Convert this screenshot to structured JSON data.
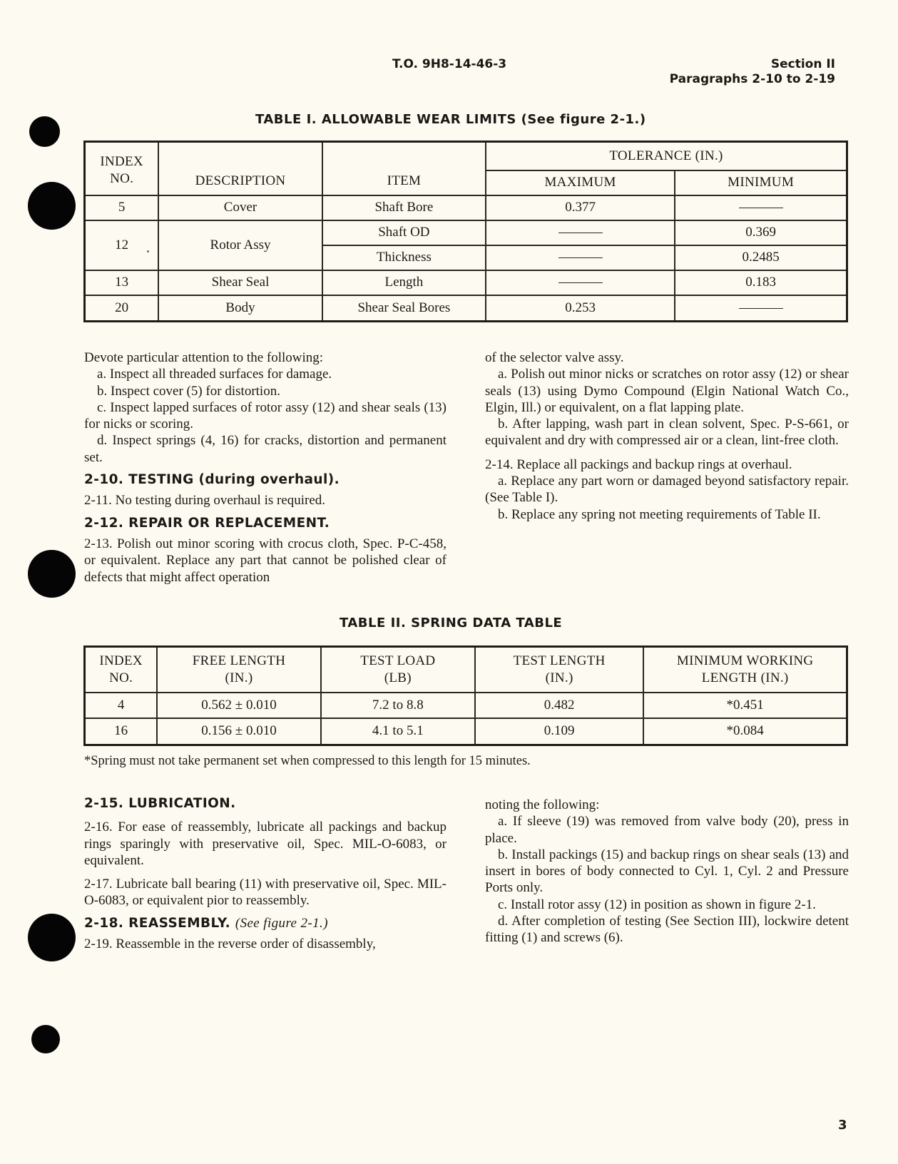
{
  "header": {
    "doc_number": "T.O. 9H8-14-46-3",
    "section": "Section II",
    "paragraphs": "Paragraphs 2-10 to 2-19"
  },
  "table1": {
    "caption": "TABLE I.  ALLOWABLE WEAR LIMITS (See figure 2-1.)",
    "headers": {
      "index_line1": "INDEX",
      "index_line2": "NO.",
      "description": "DESCRIPTION",
      "item": "ITEM",
      "tolerance": "TOLERANCE (IN.)",
      "maximum": "MAXIMUM",
      "minimum": "MINIMUM"
    },
    "rows": [
      {
        "index": "5",
        "description": "Cover",
        "item": "Shaft Bore",
        "maximum": "0.377",
        "minimum": "—"
      },
      {
        "index": "12",
        "description": "Rotor Assy",
        "item": "Shaft OD",
        "maximum": "—",
        "minimum": "0.369"
      },
      {
        "index": "",
        "description": "",
        "item": "Thickness",
        "maximum": "—",
        "minimum": "0.2485"
      },
      {
        "index": "13",
        "description": "Shear Seal",
        "item": "Length",
        "maximum": "—",
        "minimum": "0.183"
      },
      {
        "index": "20",
        "description": "Body",
        "item": "Shear Seal Bores",
        "maximum": "0.253",
        "minimum": "—"
      }
    ]
  },
  "left_col_top": {
    "intro": "Devote particular attention to the following:",
    "a": "a. Inspect all threaded surfaces for damage.",
    "b": "b. Inspect cover (5) for distortion.",
    "c": "c. Inspect lapped surfaces of rotor assy (12) and shear seals (13) for nicks or scoring.",
    "d": "d. Inspect springs (4, 16) for cracks, distortion and permanent set.",
    "h_2_10": "2-10. TESTING (during overhaul).",
    "p_2_11": "2-11. No testing during overhaul is required.",
    "h_2_12": "2-12. REPAIR OR REPLACEMENT.",
    "p_2_13": "2-13. Polish out minor scoring with crocus cloth, Spec. P-C-458, or equivalent. Replace any part that cannot be polished clear of defects that might affect operation"
  },
  "right_col_top": {
    "cont": "of the selector valve assy.",
    "a": "a. Polish out minor nicks or scratches on rotor assy (12) or shear seals (13) using Dymo Compound (Elgin National Watch Co., Elgin, Ill.) or equivalent, on a flat lapping plate.",
    "b": "b. After lapping, wash part in clean solvent, Spec. P-S-661, or equivalent and dry with compressed air or a clean, lint-free cloth.",
    "p_2_14": "2-14. Replace all packings and backup rings at overhaul.",
    "a2": "a. Replace any part worn or damaged beyond satisfactory repair. (See Table I).",
    "b2": "b. Replace any spring not meeting requirements of Table II."
  },
  "table2": {
    "caption": "TABLE II.  SPRING DATA TABLE",
    "headers": {
      "index_line1": "INDEX",
      "index_line2": "NO.",
      "free_length_line1": "FREE LENGTH",
      "free_length_line2": "(IN.)",
      "test_load_line1": "TEST LOAD",
      "test_load_line2": "(LB)",
      "test_length_line1": "TEST LENGTH",
      "test_length_line2": "(IN.)",
      "min_working_line1": "MINIMUM WORKING",
      "min_working_line2": "LENGTH (IN.)"
    },
    "rows": [
      {
        "index": "4",
        "free_length": "0.562 ± 0.010",
        "test_load": "7.2 to 8.8",
        "test_length": "0.482",
        "min_working": "*0.451"
      },
      {
        "index": "16",
        "free_length": "0.156 ± 0.010",
        "test_load": "4.1 to 5.1",
        "test_length": "0.109",
        "min_working": "*0.084"
      }
    ],
    "footnote": "*Spring must not take permanent set when compressed to this length for 15 minutes."
  },
  "left_col_bottom": {
    "h_2_15": "2-15. LUBRICATION.",
    "p_2_16": "2-16. For ease of reassembly, lubricate all packings and backup rings sparingly with preservative oil, Spec. MIL-O-6083, or equivalent.",
    "p_2_17": "2-17. Lubricate ball bearing (11) with preservative oil, Spec. MIL-O-6083, or equivalent pior to reassembly.",
    "h_2_18": "2-18. REASSEMBLY.",
    "h_2_18_ref": "(See figure 2-1.)",
    "p_2_19": "2-19. Reassemble in the reverse order of disassembly,"
  },
  "right_col_bottom": {
    "cont": "noting the following:",
    "a": "a. If sleeve (19) was removed from valve body (20), press in place.",
    "b": "b. Install packings (15) and backup rings on shear seals (13) and insert in bores of body connected to Cyl. 1, Cyl. 2 and Pressure Ports only.",
    "c": "c. Install rotor assy (12) in position as shown in figure 2-1.",
    "d": "d. After completion of testing (See Section III), lockwire detent fitting (1) and screws (6)."
  },
  "page_number": "3"
}
